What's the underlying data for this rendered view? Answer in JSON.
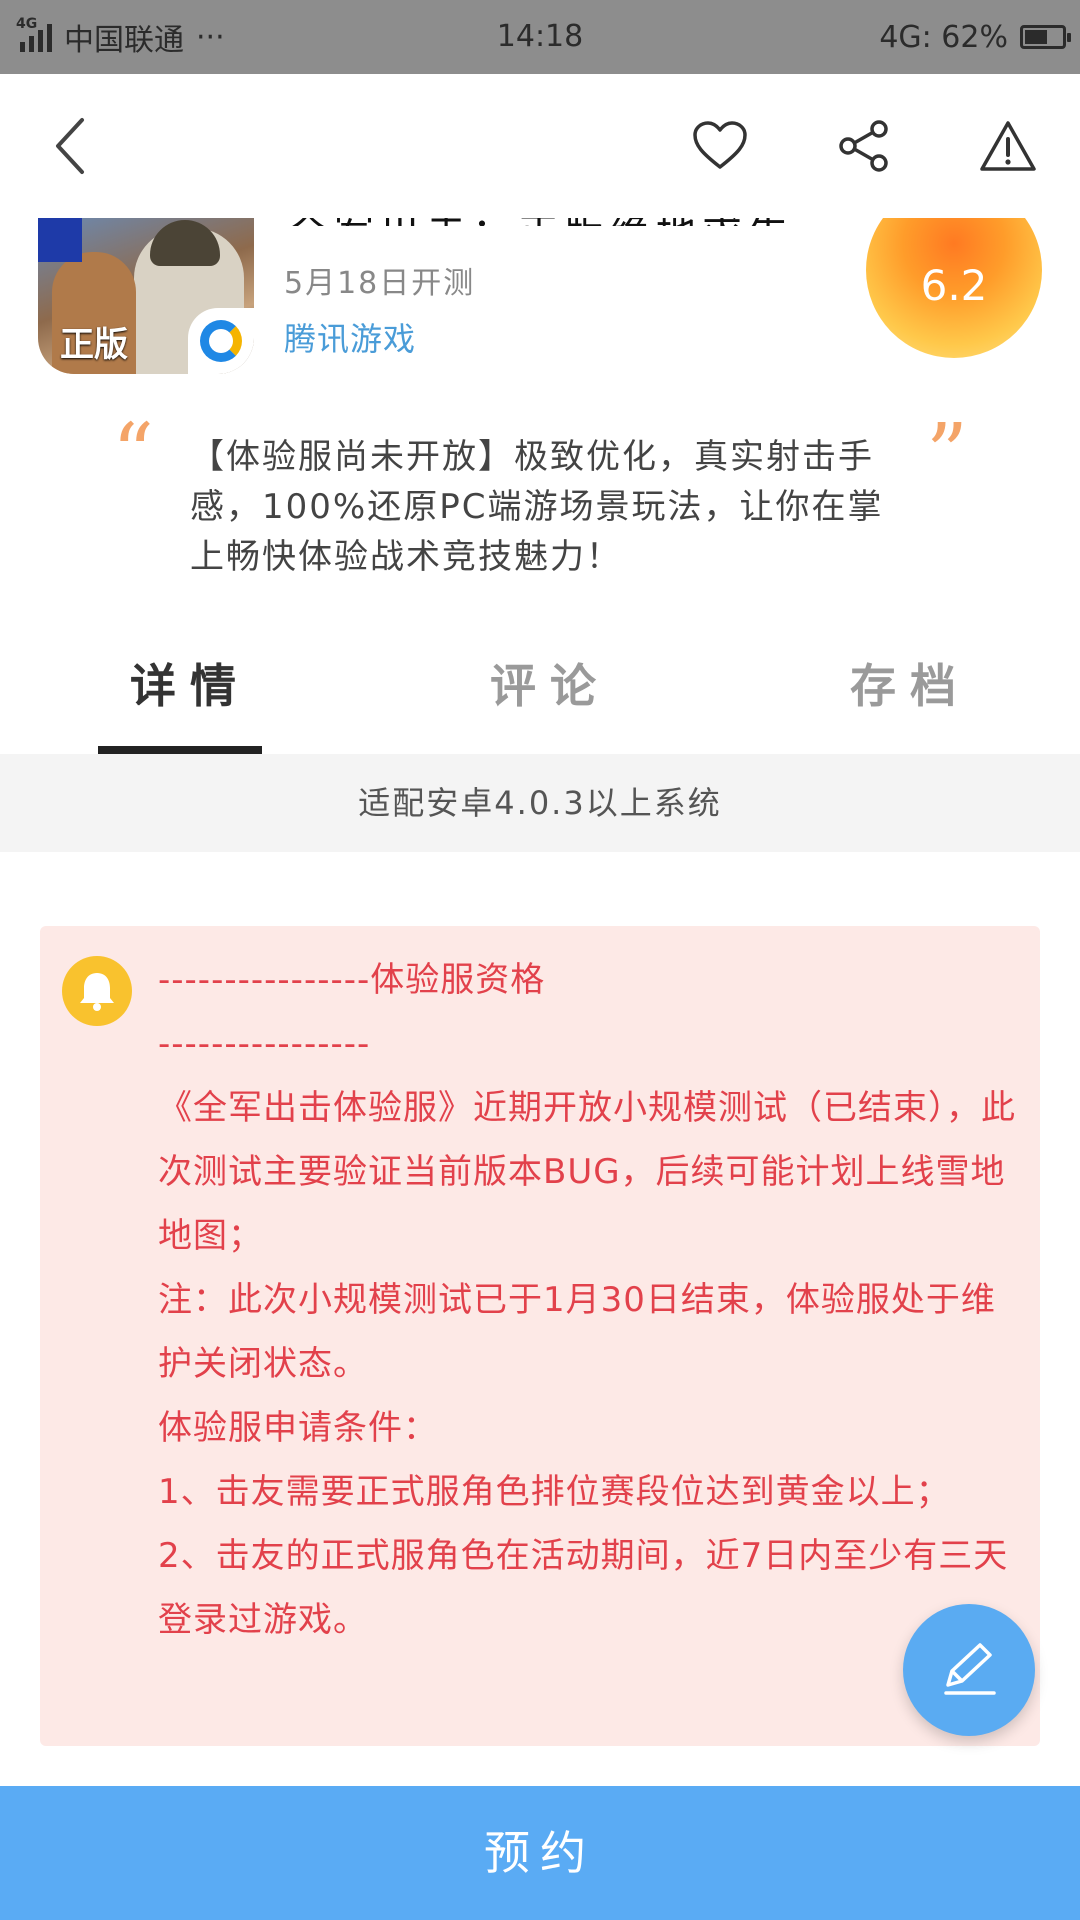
{
  "status_bar": {
    "network": "4G",
    "carrier": "中国联通",
    "more": "···",
    "time": "14:18",
    "net_battery": "4G: 62%",
    "battery_level": 0.62
  },
  "game": {
    "title": "全军出击：正版绝地求生",
    "icon_tag": "正版",
    "date": "5月18日开测",
    "publisher": "腾讯游戏",
    "score": "6.2"
  },
  "description": {
    "quote_open": "“",
    "quote_close": "”",
    "text": "【体验服尚未开放】极致优化，真实射击手感，100%还原PC端游场景玩法，让你在掌上畅快体验战术竞技魅力！"
  },
  "tabs": [
    {
      "label": "详情"
    },
    {
      "label": "评论"
    },
    {
      "label": "存档"
    }
  ],
  "compat": "适配安卓4.0.3以上系统",
  "notice": {
    "lines": [
      "----------------体验服资格",
      "----------------",
      "《全军出击体验服》近期开放小规模测试（已结束），此次测试主要验证当前版本BUG，后续可能计划上线雪地地图；",
      "注：此次小规模测试已于1月30日结束，体验服处于维护关闭状态。",
      "体验服申请条件：",
      "1、击友需要正式服角色排位赛段位达到黄金以上；",
      "2、击友的正式服角色在活动期间，近7日内至少有三天登录过游戏。"
    ]
  },
  "reserve_label": "预约",
  "colors": {
    "status_bar": "#8d8d8d",
    "accent_blue": "#5aabf4",
    "notice_bg": "#fde9e6",
    "notice_text": "#e2414b",
    "quote": "#f4a468",
    "bell": "#f9c22e"
  },
  "icons": {
    "back": "chevron-left-icon",
    "favorite": "heart-icon",
    "share": "share-icon",
    "report": "warning-icon",
    "notice": "bell-icon",
    "fab": "pencil-icon"
  }
}
